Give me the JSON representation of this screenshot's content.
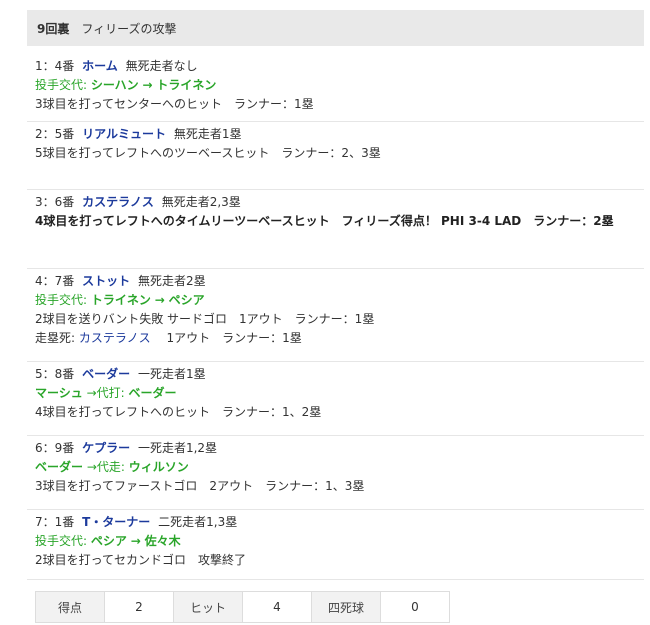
{
  "header": {
    "inning": "9回裏",
    "title": "フィリーズの攻撃"
  },
  "events": [
    {
      "num": "1：4番",
      "player": "ホーム",
      "situation": "無死走者なし",
      "sub_label": "投手交代:",
      "sub_a": "シーハン",
      "sub_arrow": "→",
      "sub_b": "トライネン",
      "result": "3球目を打ってセンターへのヒット　ランナー：1塁"
    },
    {
      "num": "2：5番",
      "player": "リアルミュート",
      "situation": "無死走者1塁",
      "result": "5球目を打ってレフトへのツーベースヒット　ランナー：2、3塁"
    },
    {
      "num": "3：6番",
      "player": "カステラノス",
      "situation": "無死走者2,3塁",
      "result": "4球目を打ってレフトへのタイムリーツーベースヒット　フィリーズ得点！ PHI 3-4 LAD　ランナー：2塁"
    },
    {
      "num": "4：7番",
      "player": "ストット",
      "situation": "無死走者2塁",
      "sub_label": "投手交代:",
      "sub_a": "トライネン",
      "sub_arrow": "→",
      "sub_b": "ペシア",
      "result": "2球目を送りバント失敗 サードゴロ　1アウト　ランナー：1塁",
      "extra_label": "走塁死:",
      "extra_player": "カステラノス",
      "extra_text": "1アウト　ランナー：1塁"
    },
    {
      "num": "5：8番",
      "player": "ベーダー",
      "situation": "一死走者1塁",
      "sub_a": "マーシュ",
      "sub_arrow": "→代打:",
      "sub_b": "ベーダー",
      "result": "4球目を打ってレフトへのヒット　ランナー：1、2塁"
    },
    {
      "num": "6：9番",
      "player": "ケプラー",
      "situation": "一死走者1,2塁",
      "sub_a": "ベーダー",
      "sub_arrow": "→代走:",
      "sub_b": "ウィルソン",
      "result": "3球目を打ってファーストゴロ　2アウト　ランナー：1、3塁"
    },
    {
      "num": "7：1番",
      "player": "T・ターナー",
      "situation": "二死走者1,3塁",
      "sub_label": "投手交代:",
      "sub_a": "ペシア",
      "sub_arrow": "→",
      "sub_b": "佐々木",
      "result": "2球目を打ってセカンドゴロ　攻撃終了"
    }
  ],
  "stats": {
    "runs_label": "得点",
    "runs": "2",
    "hits_label": "ヒット",
    "hits": "4",
    "walks_label": "四死球",
    "walks": "0"
  }
}
